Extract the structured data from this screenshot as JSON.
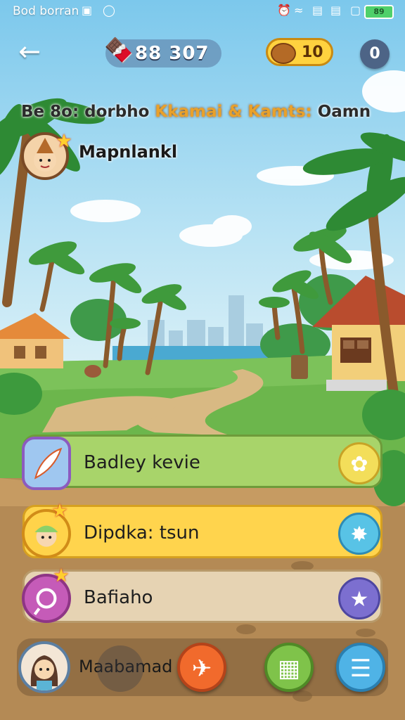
{
  "status_bar": {
    "carrier": "Bod borran",
    "battery": "89"
  },
  "hud": {
    "coins": "88 307",
    "gems": "10",
    "round_button": "0"
  },
  "quest": {
    "prefix": "Be 8o: dorbho ",
    "highlight": "Kkamai & Kamts: ",
    "suffix": "Oamn"
  },
  "player": {
    "name": "Mapnlankl"
  },
  "menu": {
    "items": [
      {
        "label": "Badley kevie"
      },
      {
        "label": "Dipdka: tsun"
      },
      {
        "label": "Bafiaho"
      }
    ]
  },
  "bottom": {
    "name": "Maabamad"
  },
  "colors": {
    "sky": "#9ad3ee",
    "grass": "#7cc25a",
    "path": "#d8b983"
  }
}
